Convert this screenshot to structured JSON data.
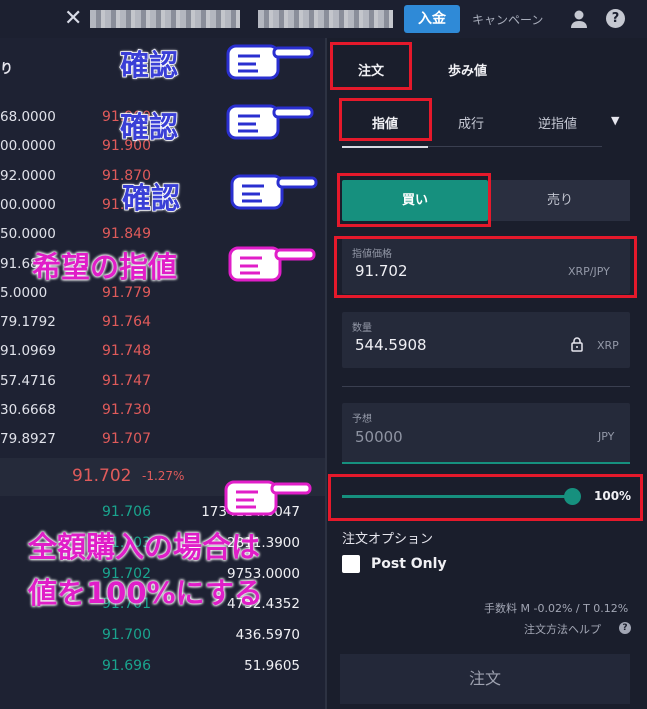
{
  "topbar": {
    "deposit_label": "入金",
    "campaign_label": "キャンペーン"
  },
  "orderbook": {
    "header_left": "り",
    "rows": [
      {
        "amount": "68.0000",
        "price": "91.900"
      },
      {
        "amount": "00.0000",
        "price": "91.900"
      },
      {
        "amount": "92.0000",
        "price": "91.870"
      },
      {
        "amount": "00.0000",
        "price": "91.860"
      },
      {
        "amount": "50.0000",
        "price": "91.849"
      },
      {
        "amount": "91.68",
        "price": ""
      },
      {
        "amount": "5.0000",
        "price": "91.779"
      },
      {
        "amount": "79.1792",
        "price": "91.764"
      },
      {
        "amount": "91.0969",
        "price": "91.748"
      },
      {
        "amount": "57.4716",
        "price": "91.747"
      },
      {
        "amount": "30.6668",
        "price": "91.730"
      },
      {
        "amount": "79.8927",
        "price": "91.707"
      }
    ],
    "mid_price": "91.702",
    "mid_change": "-1.27%",
    "bids": [
      {
        "price": "91.706",
        "amount": "1734114.0047"
      },
      {
        "price": "91.703",
        "amount": "2811.3900"
      },
      {
        "price": "91.702",
        "amount": "9753.0000"
      },
      {
        "price": "91.701",
        "amount": "4732.4352"
      },
      {
        "price": "91.700",
        "amount": "436.5970"
      },
      {
        "price": "91.696",
        "amount": "51.9605"
      }
    ]
  },
  "panel": {
    "tabs": [
      "注文",
      "歩み値"
    ],
    "order_types": [
      "指値",
      "成行",
      "逆指値"
    ],
    "side_buy": "買い",
    "side_sell": "売り",
    "price_field": {
      "label": "指値価格",
      "value": "91.702",
      "unit": "XRP/JPY"
    },
    "qty_field": {
      "label": "数量",
      "value": "544.5908",
      "unit": "XRP"
    },
    "est_field": {
      "label": "予想",
      "value": "50000",
      "unit": "JPY"
    },
    "slider_value": "100%",
    "slider_level": 1.0,
    "options_title": "注文オプション",
    "post_only": "Post Only",
    "fee_text": "手数料 M -0.02% / T 0.12%",
    "help_text": "注文方法ヘルプ",
    "order_button": "注文"
  },
  "annotations": {
    "check1": "確認",
    "check2": "確認",
    "check3": "確認",
    "limit_price": "希望の指値",
    "full_buy_1": "全額購入の場合は",
    "full_buy_2": "値を100%にする"
  },
  "colors": {
    "accent_green": "#16907e",
    "ask_red": "#e05b5b",
    "deposit_blue": "#2f8ad7",
    "highlight_red": "#e5192b",
    "annot_pink": "#e01ec8",
    "annot_blue": "#3a3fd6"
  }
}
